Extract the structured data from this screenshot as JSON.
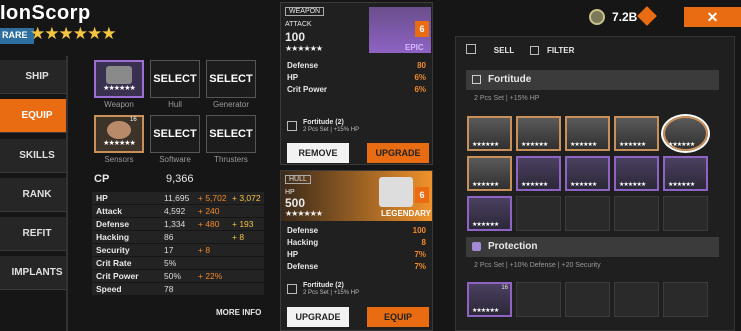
{
  "header": {
    "title": "IonScorp",
    "rarity": "RARE",
    "stars": "★★★★★★",
    "currency_value": "7.2B",
    "close_label": "✕"
  },
  "nav": {
    "items": [
      {
        "label": "SHIP"
      },
      {
        "label": "EQUIP"
      },
      {
        "label": "SKILLS"
      },
      {
        "label": "RANK"
      },
      {
        "label": "REFIT"
      },
      {
        "label": "IMPLANTS"
      }
    ]
  },
  "slots": [
    {
      "label": "Weapon",
      "button": "",
      "stars": "★★★★★★"
    },
    {
      "label": "Hull",
      "button": "SELECT"
    },
    {
      "label": "Generator",
      "button": "SELECT"
    },
    {
      "label": "Sensors",
      "button": "",
      "stars": "★★★★★★",
      "badge": "16"
    },
    {
      "label": "Software",
      "button": "SELECT"
    },
    {
      "label": "Thrusters",
      "button": "SELECT"
    }
  ],
  "cp": {
    "label": "CP",
    "value": "9,366"
  },
  "stats": [
    {
      "name": "HP",
      "value": "11,695",
      "b1": "+ 5,702",
      "b2": "+ 3,072"
    },
    {
      "name": "Attack",
      "value": "4,592",
      "b1": "+ 240",
      "b2": ""
    },
    {
      "name": "Defense",
      "value": "1,334",
      "b1": "+ 480",
      "b2": "+ 193"
    },
    {
      "name": "Hacking",
      "value": "86",
      "b1": "",
      "b2": "+ 8"
    },
    {
      "name": "Security",
      "value": "17",
      "b1": "+ 8",
      "b2": ""
    },
    {
      "name": "Crit Rate",
      "value": "5%",
      "b1": "",
      "b2": ""
    },
    {
      "name": "Crit Power",
      "value": "50%",
      "b1": "+ 22%",
      "b2": ""
    },
    {
      "name": "Speed",
      "value": "78",
      "b1": "",
      "b2": ""
    }
  ],
  "more_info": "MORE INFO",
  "weapon_card": {
    "tag": "WEAPON",
    "stat_name": "ATTACK",
    "stat_value": "100",
    "stars": "★★★★★★",
    "rarity": "EPIC",
    "lock_level": "6",
    "rows": [
      {
        "k": "Defense",
        "v": "80"
      },
      {
        "k": "HP",
        "v": "6%"
      },
      {
        "k": "Crit Power",
        "v": "6%"
      }
    ],
    "set_name": "Fortitude (2)",
    "set_desc": "2 Pcs Set | +15% HP",
    "btn_left": "REMOVE",
    "btn_right": "UPGRADE"
  },
  "hull_card": {
    "tag": "HULL",
    "stat_name": "HP",
    "stat_value": "500",
    "stars": "★★★★★★",
    "rarity": "LEGENDARY",
    "lock_level": "6",
    "rows": [
      {
        "k": "Defense",
        "v": "100"
      },
      {
        "k": "Hacking",
        "v": "8"
      },
      {
        "k": "HP",
        "v": "7%"
      },
      {
        "k": "Defense",
        "v": "7%"
      }
    ],
    "set_name": "Fortitude (2)",
    "set_desc": "2 Pcs Set | +15% HP",
    "btn_left": "UPGRADE",
    "btn_right": "EQUIP"
  },
  "toolbar": {
    "sell": "SELL",
    "filter": "FILTER"
  },
  "sets": [
    {
      "name": "Fortitude",
      "desc": "2 Pcs Set | +15% HP"
    },
    {
      "name": "Protection",
      "desc": "2 Pcs Set | +10% Defense | +20 Security"
    }
  ],
  "tile_stars": "★★★★★★",
  "protection_badge": "16",
  "colors": {
    "accent": "#ea6c12",
    "epic": "#9b6fd3",
    "legendary": "#f0922c",
    "background": "#161616"
  }
}
